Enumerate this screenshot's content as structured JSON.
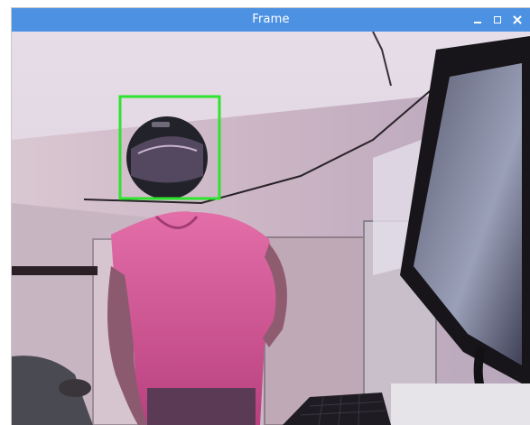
{
  "window": {
    "title": "Frame",
    "controls": {
      "minimize_icon": "minimize-icon",
      "maximize_icon": "maximize-icon",
      "close_icon": "close-icon"
    },
    "titlebar_color": "#4d92e2"
  },
  "frame": {
    "detection": {
      "color": "#2fe32f"
    }
  }
}
